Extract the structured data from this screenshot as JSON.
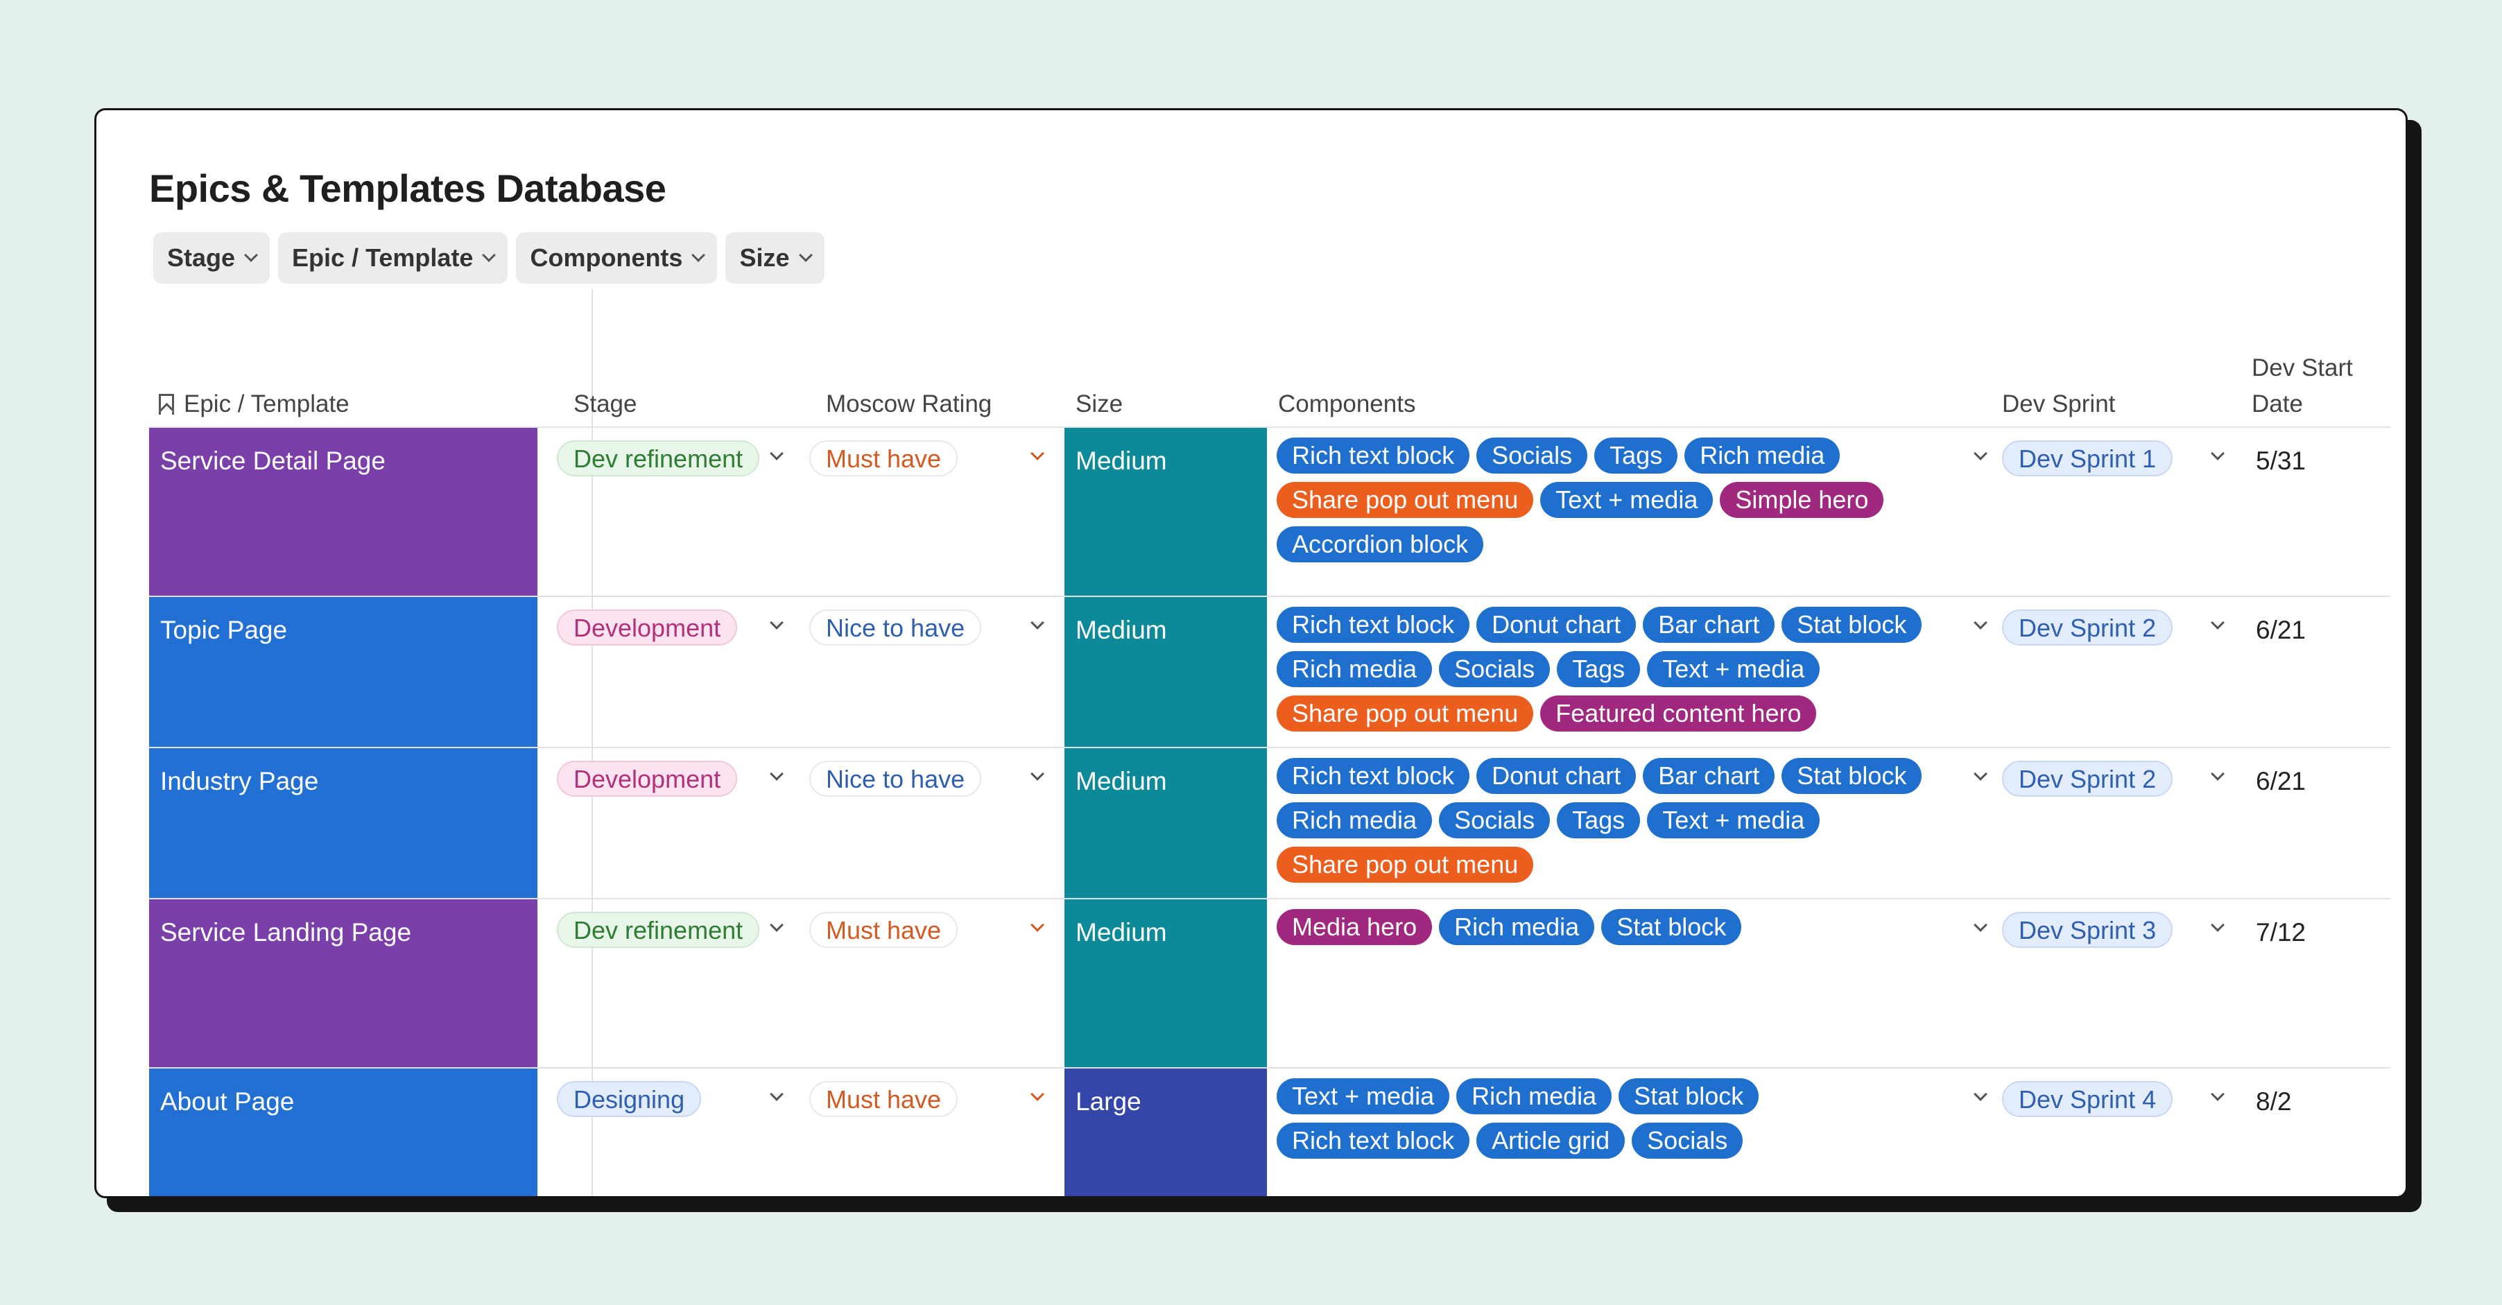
{
  "title": "Epics & Templates Database",
  "filters": [
    "Stage",
    "Epic / Template",
    "Components",
    "Size"
  ],
  "columns": {
    "epic": "Epic / Template",
    "stage": "Stage",
    "moscow": "Moscow Rating",
    "size": "Size",
    "components": "Components",
    "sprint": "Dev Sprint",
    "date": "Dev Start Date"
  },
  "colors": {
    "purple": "#7a3fa8",
    "blue": "#2370d4",
    "teal": "#0d8a99",
    "indigo": "#3447a8",
    "tag_blue": "#1f6fcf",
    "tag_orange": "#ec5e1e",
    "tag_magenta": "#a0287f"
  },
  "rows": [
    {
      "name": "Service Detail Page",
      "name_color": "purple",
      "stage": "Dev refinement",
      "moscow": "Must have",
      "size": "Medium",
      "size_color": "teal",
      "components": [
        {
          "label": "Rich text block",
          "color": "tag_blue"
        },
        {
          "label": "Socials",
          "color": "tag_blue"
        },
        {
          "label": "Tags",
          "color": "tag_blue"
        },
        {
          "label": "Rich media",
          "color": "tag_blue"
        },
        {
          "label": "Share pop out menu",
          "color": "tag_orange"
        },
        {
          "label": "Text + media",
          "color": "tag_blue"
        },
        {
          "label": "Simple hero",
          "color": "tag_magenta"
        },
        {
          "label": "Accordion block",
          "color": "tag_blue"
        }
      ],
      "sprint": "Dev Sprint 1",
      "date": "5/31"
    },
    {
      "name": "Topic Page",
      "name_color": "blue",
      "stage": "Development",
      "moscow": "Nice to have",
      "size": "Medium",
      "size_color": "teal",
      "components": [
        {
          "label": "Rich text block",
          "color": "tag_blue"
        },
        {
          "label": "Donut chart",
          "color": "tag_blue"
        },
        {
          "label": "Bar chart",
          "color": "tag_blue"
        },
        {
          "label": "Stat block",
          "color": "tag_blue"
        },
        {
          "label": "Rich media",
          "color": "tag_blue"
        },
        {
          "label": "Socials",
          "color": "tag_blue"
        },
        {
          "label": "Tags",
          "color": "tag_blue"
        },
        {
          "label": "Text + media",
          "color": "tag_blue"
        },
        {
          "label": "Share pop out menu",
          "color": "tag_orange"
        },
        {
          "label": "Featured content hero",
          "color": "tag_magenta"
        }
      ],
      "sprint": "Dev Sprint 2",
      "date": "6/21"
    },
    {
      "name": "Industry Page",
      "name_color": "blue",
      "stage": "Development",
      "moscow": "Nice to have",
      "size": "Medium",
      "size_color": "teal",
      "components": [
        {
          "label": "Rich text block",
          "color": "tag_blue"
        },
        {
          "label": "Donut chart",
          "color": "tag_blue"
        },
        {
          "label": "Bar chart",
          "color": "tag_blue"
        },
        {
          "label": "Stat block",
          "color": "tag_blue"
        },
        {
          "label": "Rich media",
          "color": "tag_blue"
        },
        {
          "label": "Socials",
          "color": "tag_blue"
        },
        {
          "label": "Tags",
          "color": "tag_blue"
        },
        {
          "label": "Text + media",
          "color": "tag_blue"
        },
        {
          "label": "Share pop out menu",
          "color": "tag_orange"
        }
      ],
      "sprint": "Dev Sprint 2",
      "date": "6/21"
    },
    {
      "name": "Service Landing Page",
      "name_color": "purple",
      "stage": "Dev refinement",
      "moscow": "Must have",
      "size": "Medium",
      "size_color": "teal",
      "components": [
        {
          "label": "Media hero",
          "color": "tag_magenta"
        },
        {
          "label": "Rich media",
          "color": "tag_blue"
        },
        {
          "label": "Stat block",
          "color": "tag_blue"
        }
      ],
      "sprint": "Dev Sprint 3",
      "date": "7/12"
    },
    {
      "name": "About Page",
      "name_color": "blue",
      "stage": "Designing",
      "moscow": "Must have",
      "size": "Large",
      "size_color": "indigo",
      "components": [
        {
          "label": "Text + media",
          "color": "tag_blue"
        },
        {
          "label": "Rich media",
          "color": "tag_blue"
        },
        {
          "label": "Stat block",
          "color": "tag_blue"
        },
        {
          "label": "Rich text block",
          "color": "tag_blue"
        },
        {
          "label": "Article grid",
          "color": "tag_blue"
        },
        {
          "label": "Socials",
          "color": "tag_blue"
        }
      ],
      "sprint": "Dev Sprint 4",
      "date": "8/2"
    }
  ]
}
